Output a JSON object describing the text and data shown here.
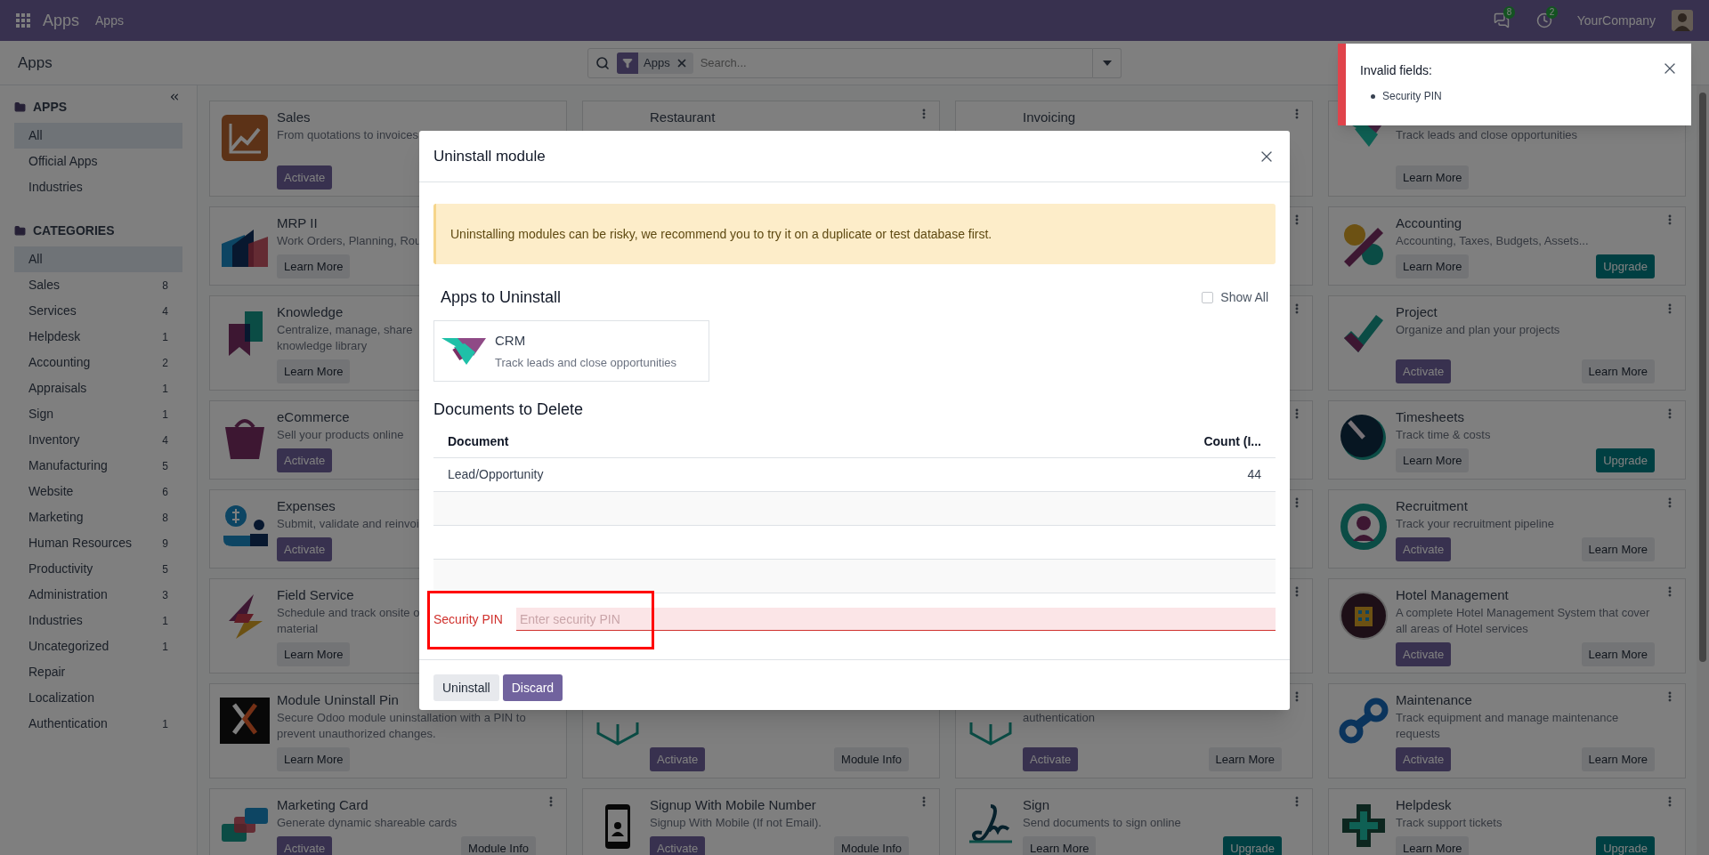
{
  "navbar": {
    "brand": "Apps",
    "menu": [
      "Apps"
    ],
    "messages_badge": "8",
    "activities_badge": "2",
    "company": "YourCompany"
  },
  "control_panel": {
    "breadcrumb": "Apps",
    "search": {
      "facet": "Apps",
      "placeholder": "Search..."
    }
  },
  "sidebar": {
    "sections": [
      {
        "title": "APPS",
        "items": [
          {
            "label": "All",
            "selected": true
          },
          {
            "label": "Official Apps",
            "selected": false
          },
          {
            "label": "Industries",
            "selected": false
          }
        ]
      },
      {
        "title": "CATEGORIES",
        "items": [
          {
            "label": "All",
            "selected": true
          },
          {
            "label": "Sales",
            "count": "8",
            "selected": false
          },
          {
            "label": "Services",
            "count": "4",
            "selected": false
          },
          {
            "label": "Helpdesk",
            "count": "1",
            "selected": false
          },
          {
            "label": "Accounting",
            "count": "2",
            "selected": false
          },
          {
            "label": "Appraisals",
            "count": "1",
            "selected": false
          },
          {
            "label": "Sign",
            "count": "1",
            "selected": false
          },
          {
            "label": "Inventory",
            "count": "4",
            "selected": false
          },
          {
            "label": "Manufacturing",
            "count": "5",
            "selected": false
          },
          {
            "label": "Website",
            "count": "6",
            "selected": false
          },
          {
            "label": "Marketing",
            "count": "8",
            "selected": false
          },
          {
            "label": "Human Resources",
            "count": "9",
            "selected": false
          },
          {
            "label": "Productivity",
            "count": "5",
            "selected": false
          },
          {
            "label": "Administration",
            "count": "3",
            "selected": false
          },
          {
            "label": "Industries",
            "count": "1",
            "selected": false
          },
          {
            "label": "Uncategorized",
            "count": "1",
            "selected": false
          },
          {
            "label": "Repair",
            "selected": false
          },
          {
            "label": "Localization",
            "selected": false
          },
          {
            "label": "Authentication",
            "count": "1",
            "selected": false
          }
        ]
      }
    ]
  },
  "card_rows": [
    {
      "cards": [
        {
          "title": "Sales",
          "description": [
            "From quotations to invoices"
          ],
          "buttons": [
            {
              "label": "Activate",
              "kind": "activate"
            }
          ]
        },
        {
          "title": "Restaurant",
          "menu": true
        },
        {
          "title": "Invoicing",
          "menu": true
        },
        {
          "description": [
            "Track leads and close opportunities"
          ],
          "buttons": [
            {
              "label": "Learn More",
              "kind": "secondary"
            }
          ]
        }
      ]
    },
    {
      "cards": [
        {
          "title": "MRP II",
          "description": [
            "Work Orders, Planning, Rou"
          ],
          "buttons": [
            {
              "label": "Learn More",
              "kind": "secondary"
            }
          ]
        },
        {
          "menu": true
        },
        {
          "title": "Accounting",
          "description": [
            "Accounting, Taxes, Budgets, Assets..."
          ],
          "buttons": [
            {
              "label": "Learn More",
              "kind": "secondary"
            },
            {
              "label": "Upgrade",
              "kind": "upgrade"
            }
          ],
          "menu": true
        }
      ]
    },
    {
      "cards": [
        {
          "title": "Knowledge",
          "description": [
            "Centralize, manage, share",
            "knowledge library"
          ],
          "buttons": [
            {
              "label": "Learn More",
              "kind": "secondary"
            }
          ]
        },
        {
          "menu": true
        },
        {
          "title": "Project",
          "description": [
            "Organize and plan your projects"
          ],
          "buttons": [
            {
              "label": "Activate",
              "kind": "activate"
            },
            {
              "label": "Learn More",
              "kind": "secondary"
            }
          ],
          "menu": true
        }
      ]
    },
    {
      "cards": [
        {
          "title": "eCommerce",
          "description": [
            "Sell your products online"
          ],
          "buttons": [
            {
              "label": "Activate",
              "kind": "activate"
            }
          ]
        },
        {
          "menu": true
        },
        {
          "title": "Timesheets",
          "description": [
            "Track time & costs"
          ],
          "buttons": [
            {
              "label": "Learn More",
              "kind": "secondary"
            },
            {
              "label": "Upgrade",
              "kind": "upgrade"
            }
          ],
          "menu": true
        }
      ]
    },
    {
      "cards": [
        {
          "title": "Expenses",
          "description": [
            "Submit, validate and reinvoi"
          ],
          "buttons": [
            {
              "label": "Activate",
              "kind": "activate"
            }
          ]
        },
        {
          "menu": true
        },
        {
          "title": "Recruitment",
          "description": [
            "Track your recruitment pipeline"
          ],
          "buttons": [
            {
              "label": "Activate",
              "kind": "activate"
            },
            {
              "label": "Learn More",
              "kind": "secondary"
            }
          ],
          "menu": true
        }
      ]
    },
    {
      "cards": [
        {
          "title": "Field Service",
          "description": [
            "Schedule and track onsite o",
            "material"
          ],
          "buttons": [
            {
              "label": "Learn More",
              "kind": "secondary"
            }
          ]
        },
        {
          "menu": true
        },
        {
          "title": "Hotel Management",
          "description": [
            "A complete Hotel Management System that cover",
            "all areas of Hotel services"
          ],
          "buttons": [
            {
              "label": "Activate",
              "kind": "activate"
            },
            {
              "label": "Learn More",
              "kind": "secondary"
            }
          ],
          "menu": true
        }
      ]
    },
    {
      "cards": [
        {
          "title": "Module Uninstall Pin",
          "description": [
            "Secure Odoo module uninstallation with a PIN to",
            "prevent unauthorized changes."
          ],
          "buttons": [
            {
              "label": "Learn More",
              "kind": "secondary"
            }
          ]
        },
        {
          "buttons": [
            {
              "label": "Activate",
              "kind": "activate"
            },
            {
              "label": "Module Info",
              "kind": "secondary"
            }
          ]
        },
        {
          "description": [
            "authentication"
          ],
          "buttons": [
            {
              "label": "Activate",
              "kind": "activate"
            },
            {
              "label": "Learn More",
              "kind": "secondary"
            }
          ],
          "menu": true
        },
        {
          "title": "Maintenance",
          "description": [
            "Track equipment and manage maintenance",
            "requests"
          ],
          "buttons": [
            {
              "label": "Activate",
              "kind": "activate"
            },
            {
              "label": "Learn More",
              "kind": "secondary"
            }
          ],
          "menu": true
        }
      ]
    },
    {
      "cards": [
        {
          "title": "Marketing Card",
          "description": [
            "Generate dynamic shareable cards"
          ],
          "buttons": [
            {
              "label": "Activate",
              "kind": "activate"
            },
            {
              "label": "Module Info",
              "kind": "secondary"
            }
          ],
          "menu": true
        },
        {
          "title": "Signup With Mobile Number",
          "description": [
            "Signup With Mobile (If not Email)."
          ],
          "buttons": [
            {
              "label": "Activate",
              "kind": "activate"
            },
            {
              "label": "Module Info",
              "kind": "secondary"
            }
          ],
          "menu": true
        },
        {
          "title": "Sign",
          "description": [
            "Send documents to sign online"
          ],
          "buttons": [
            {
              "label": "Learn More",
              "kind": "secondary"
            },
            {
              "label": "Upgrade",
              "kind": "upgrade"
            }
          ],
          "menu": true
        },
        {
          "title": "Helpdesk",
          "description": [
            "Track support tickets"
          ],
          "buttons": [
            {
              "label": "Learn More",
              "kind": "secondary"
            },
            {
              "label": "Upgrade",
              "kind": "upgrade"
            }
          ],
          "menu": true
        }
      ]
    }
  ],
  "toast": {
    "title": "Invalid fields:",
    "items": [
      "Security PIN"
    ]
  },
  "dialog": {
    "title": "Uninstall module",
    "alert": "Uninstalling modules can be risky, we recommend you to try it on a duplicate or test database first.",
    "apps_heading": "Apps to Uninstall",
    "show_all": {
      "label": "Show All",
      "checked": false
    },
    "apps": [
      {
        "name": "CRM",
        "description": "Track leads and close opportunities"
      }
    ],
    "documents_heading": "Documents to Delete",
    "table": {
      "columns": [
        "Document",
        "Count (I..."
      ],
      "rows": [
        {
          "document": "Lead/Opportunity",
          "count": "44"
        }
      ]
    },
    "pin": {
      "label": "Security PIN",
      "placeholder": "Enter security PIN",
      "invalid": true
    },
    "buttons": [
      {
        "label": "Uninstall",
        "kind": "secondary"
      },
      {
        "label": "Discard",
        "kind": "primary"
      }
    ]
  }
}
